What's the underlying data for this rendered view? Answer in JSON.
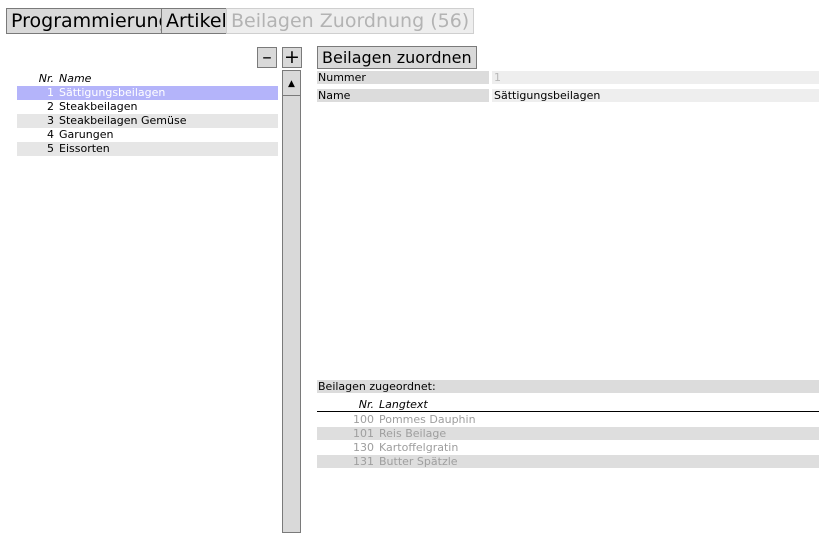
{
  "toolbar": {
    "programmierung": "Programmierung",
    "artikel": "Artikel",
    "beilagen_zuordnung": "Beilagen Zuordnung (56)"
  },
  "list_controls": {
    "remove": "–",
    "add": "+"
  },
  "list": {
    "header_nr": "Nr.",
    "header_name": "Name",
    "rows": [
      {
        "nr": "1",
        "name": "Sättigungsbeilagen"
      },
      {
        "nr": "2",
        "name": "Steakbeilagen"
      },
      {
        "nr": "3",
        "name": "Steakbeilagen Gemüse"
      },
      {
        "nr": "4",
        "name": "Garungen"
      },
      {
        "nr": "5",
        "name": "Eissorten"
      }
    ],
    "scroll_up": "▲"
  },
  "detail": {
    "assign_button": "Beilagen zuordnen",
    "nummer_label": "Nummer",
    "nummer_value": "1",
    "name_label": "Name",
    "name_value": "Sättigungsbeilagen",
    "assigned_label": "Beilagen zugeordnet:",
    "assigned_header_nr": "Nr.",
    "assigned_header_text": "Langtext",
    "assigned": [
      {
        "nr": "100",
        "text": "Pommes Dauphin"
      },
      {
        "nr": "101",
        "text": "Reis Beilage"
      },
      {
        "nr": "130",
        "text": "Kartoffelgratin"
      },
      {
        "nr": "131",
        "text": "Butter Spätzle"
      }
    ]
  },
  "colors": {
    "selected_row": "#b4b4fa",
    "button_bg": "#d9d9d9",
    "alt_row": "#e6e6e6"
  }
}
